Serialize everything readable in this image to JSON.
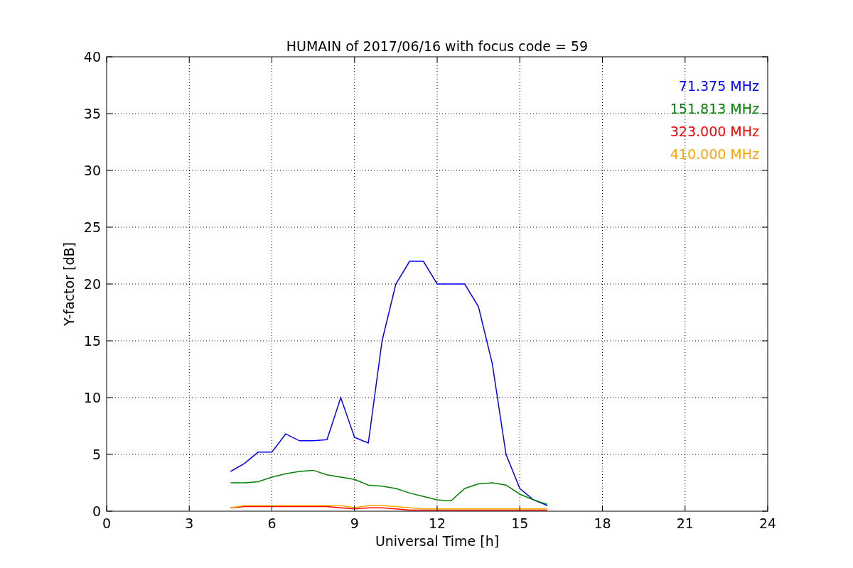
{
  "chart_data": {
    "type": "line",
    "title": "HUMAIN of 2017/06/16 with focus code = 59",
    "xlabel": "Universal Time [h]",
    "ylabel": "Y-factor [dB]",
    "x": [
      4.5,
      5,
      5.5,
      6,
      6.5,
      7,
      7.5,
      8,
      8.5,
      9,
      9.5,
      10,
      10.5,
      11,
      11.5,
      12,
      12.5,
      13,
      13.5,
      14,
      14.5,
      15,
      15.5,
      16
    ],
    "series": [
      {
        "name": "71.375 MHz",
        "color": "#0000ff",
        "values": [
          3.5,
          4.2,
          5.2,
          5.2,
          6.8,
          6.2,
          6.2,
          6.3,
          10,
          6.5,
          6,
          15,
          20,
          22,
          22,
          20,
          20,
          20,
          18,
          13,
          5,
          2,
          1,
          0.5
        ]
      },
      {
        "name": "151.813 MHz",
        "color": "#008000",
        "values": [
          2.5,
          2.5,
          2.6,
          3,
          3.3,
          3.5,
          3.6,
          3.2,
          3,
          2.8,
          2.3,
          2.2,
          2,
          1.6,
          1.3,
          1,
          0.9,
          2,
          2.4,
          2.5,
          2.3,
          1.5,
          1,
          0.6
        ]
      },
      {
        "name": "323.000 MHz",
        "color": "#ff0000",
        "values": [
          0.3,
          0.4,
          0.4,
          0.4,
          0.4,
          0.4,
          0.4,
          0.4,
          0.3,
          0.2,
          0.3,
          0.3,
          0.2,
          0.1,
          0.1,
          0.1,
          0.1,
          0.1,
          0.1,
          0.1,
          0.1,
          0.1,
          0.1,
          0.1
        ]
      },
      {
        "name": "410.000 MHz",
        "color": "#ffa500",
        "values": [
          0.3,
          0.5,
          0.5,
          0.5,
          0.5,
          0.5,
          0.5,
          0.5,
          0.5,
          0.3,
          0.5,
          0.5,
          0.4,
          0.3,
          0.2,
          0.2,
          0.2,
          0.2,
          0.2,
          0.2,
          0.2,
          0.2,
          0.2,
          0.2
        ]
      }
    ],
    "grid": true,
    "xlim": [
      0,
      24
    ],
    "ylim": [
      0,
      40
    ],
    "xticks": [
      0,
      3,
      6,
      9,
      12,
      15,
      18,
      21,
      24
    ],
    "yticks": [
      0,
      5,
      10,
      15,
      20,
      25,
      30,
      35,
      40
    ]
  }
}
